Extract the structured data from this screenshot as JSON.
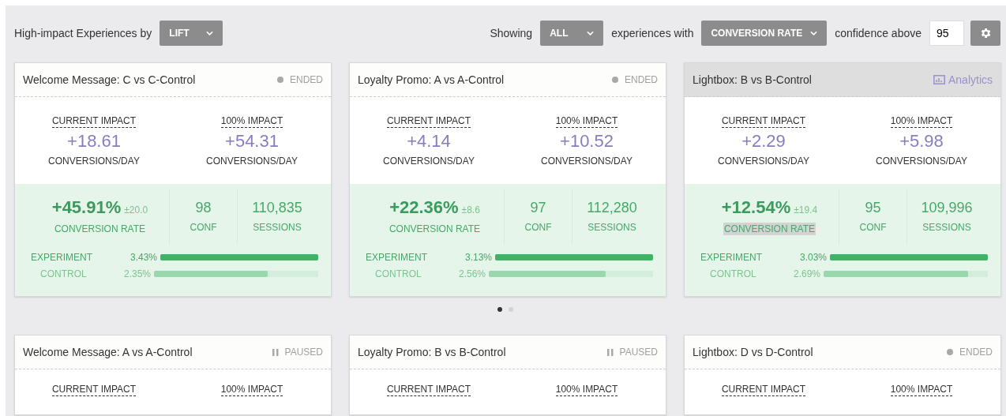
{
  "toolbar": {
    "title": "High-impact Experiences by",
    "sort_dropdown": "LIFT",
    "showing_label": "Showing",
    "showing_dropdown": "ALL",
    "with_label": "experiences with",
    "metric_dropdown": "CONVERSION RATE",
    "confidence_label": "confidence above",
    "confidence_value": "95"
  },
  "cards": [
    {
      "title": "Welcome Message: C vs C-Control",
      "highlighted": false,
      "status": {
        "kind": "ended",
        "label": "ENDED"
      },
      "impacts": [
        {
          "label": "CURRENT IMPACT",
          "value": "+18.61",
          "unit": "CONVERSIONS/DAY"
        },
        {
          "label": "100% IMPACT",
          "value": "+54.31",
          "unit": "CONVERSIONS/DAY"
        }
      ],
      "metrics": {
        "lift": "+45.91%",
        "margin": "±20.0",
        "lift_label": "CONVERSION RATE",
        "lift_label_highlighted": false,
        "conf": "98",
        "conf_label": "CONF",
        "sessions": "110,835",
        "sessions_label": "SESSIONS"
      },
      "bars": [
        {
          "kind": "experiment",
          "label": "EXPERIMENT",
          "value": "3.43%",
          "level": 1
        },
        {
          "kind": "control",
          "label": "CONTROL",
          "value": "2.35%",
          "level": 0.69
        }
      ]
    },
    {
      "title": "Loyalty Promo: A vs A-Control",
      "highlighted": false,
      "status": {
        "kind": "ended",
        "label": "ENDED"
      },
      "impacts": [
        {
          "label": "CURRENT IMPACT",
          "value": "+4.14",
          "unit": "CONVERSIONS/DAY"
        },
        {
          "label": "100% IMPACT",
          "value": "+10.52",
          "unit": "CONVERSIONS/DAY"
        }
      ],
      "metrics": {
        "lift": "+22.36%",
        "margin": "±8.6",
        "lift_label": "CONVERSION RATE",
        "lift_label_highlighted": false,
        "conf": "97",
        "conf_label": "CONF",
        "sessions": "112,280",
        "sessions_label": "SESSIONS"
      },
      "bars": [
        {
          "kind": "experiment",
          "label": "EXPERIMENT",
          "value": "3.13%",
          "level": 1
        },
        {
          "kind": "control",
          "label": "CONTROL",
          "value": "2.56%",
          "level": 0.71
        }
      ]
    },
    {
      "title": "Lightbox: B vs B-Control",
      "highlighted": true,
      "status": {
        "kind": "analytics",
        "label": "Analytics"
      },
      "impacts": [
        {
          "label": "CURRENT IMPACT",
          "value": "+2.29",
          "unit": "CONVERSIONS/DAY"
        },
        {
          "label": "100% IMPACT",
          "value": "+5.98",
          "unit": "CONVERSIONS/DAY"
        }
      ],
      "metrics": {
        "lift": "+12.54%",
        "margin": "±19.4",
        "lift_label": "CONVERSION RATE",
        "lift_label_highlighted": true,
        "conf": "95",
        "conf_label": "CONF",
        "sessions": "109,996",
        "sessions_label": "SESSIONS"
      },
      "bars": [
        {
          "kind": "experiment",
          "label": "EXPERIMENT",
          "value": "3.03%",
          "level": 1
        },
        {
          "kind": "control",
          "label": "CONTROL",
          "value": "2.69%",
          "level": 0.88
        }
      ]
    },
    {
      "title": "Welcome Message: A vs A-Control",
      "highlighted": false,
      "status": {
        "kind": "paused",
        "label": "PAUSED"
      },
      "impacts": [
        {
          "label": "CURRENT IMPACT"
        },
        {
          "label": "100% IMPACT"
        }
      ]
    },
    {
      "title": "Loyalty Promo: B vs B-Control",
      "highlighted": false,
      "status": {
        "kind": "paused",
        "label": "PAUSED"
      },
      "impacts": [
        {
          "label": "CURRENT IMPACT"
        },
        {
          "label": "100% IMPACT"
        }
      ]
    },
    {
      "title": "Lightbox: D vs D-Control",
      "highlighted": false,
      "status": {
        "kind": "ended",
        "label": "ENDED"
      },
      "impacts": [
        {
          "label": "CURRENT IMPACT"
        },
        {
          "label": "100% IMPACT"
        }
      ]
    }
  ],
  "pagination": [
    {
      "selected": true
    },
    {
      "selected": false
    }
  ]
}
